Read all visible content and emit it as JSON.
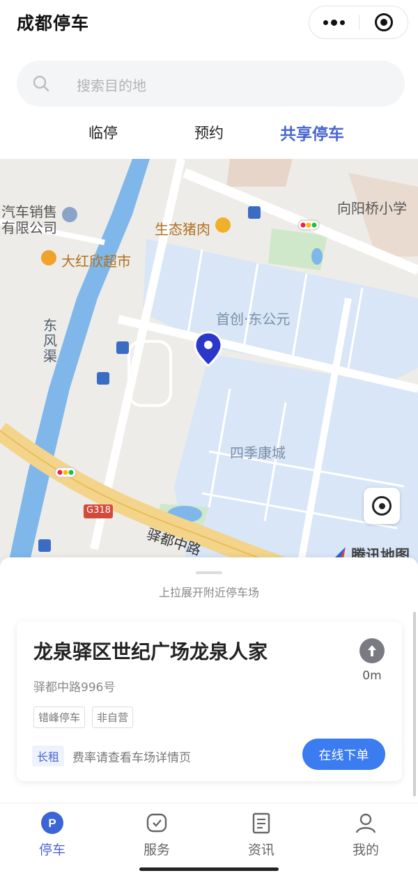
{
  "header": {
    "title": "成都停车"
  },
  "search": {
    "placeholder": "搜索目的地"
  },
  "tabs": [
    {
      "label": "临停",
      "active": false
    },
    {
      "label": "预约",
      "active": false
    },
    {
      "label": "共享停车",
      "active": true
    }
  ],
  "map": {
    "labels": {
      "car_sales_1": "汽车销售",
      "car_sales_2": "有限公司",
      "supermarket": "大红欣超市",
      "pork": "生态猪肉",
      "school": "向阳桥小学",
      "community1": "首创·东公元",
      "community2": "四季康城",
      "canal": "东风渠",
      "road": "驿都中路",
      "highway": "G318"
    },
    "logo": "腾讯地图"
  },
  "sheet": {
    "hint": "上拉展开附近停车场",
    "card": {
      "name": "龙泉驿区世纪广场龙泉人家",
      "address": "驿都中路996号",
      "tags": [
        "错峰停车",
        "非自营"
      ],
      "distance": "0m",
      "rent_badge": "长租",
      "fee_text": "费率请查看车场详情页",
      "order_button": "在线下单"
    }
  },
  "nav": [
    {
      "label": "停车",
      "icon": "parking-icon",
      "active": true
    },
    {
      "label": "服务",
      "icon": "service-icon",
      "active": false
    },
    {
      "label": "资讯",
      "icon": "news-icon",
      "active": false
    },
    {
      "label": "我的",
      "icon": "profile-icon",
      "active": false
    }
  ],
  "colors": {
    "accent": "#4a66d3",
    "button": "#3b7cf0"
  }
}
